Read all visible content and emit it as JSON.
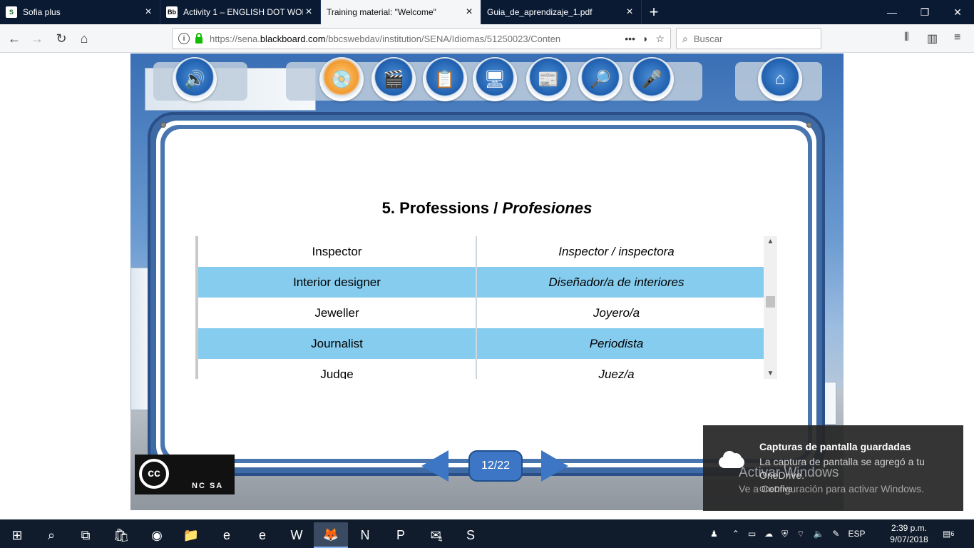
{
  "browser": {
    "tabs": [
      {
        "title": "Sofia plus",
        "favicon": "sofia-plus-icon"
      },
      {
        "title": "Activity 1 – ENGLISH DOT WOR",
        "favicon": "blackboard-icon"
      },
      {
        "title": "Training material: \"Welcome\"",
        "favicon": "none",
        "active": true
      },
      {
        "title": "Guia_de_aprendizaje_1.pdf",
        "favicon": "none"
      }
    ],
    "url_prefix": "https://sena.",
    "url_domain": "blackboard.com",
    "url_rest": "/bbcswebdav/institution/SENA/Idiomas/51250023/Conten",
    "url_more": "•••",
    "search_placeholder": "Buscar",
    "new_tab": "+",
    "nav": {
      "back": "←",
      "forward": "→",
      "reload": "↻",
      "home": "⌂"
    }
  },
  "lesson": {
    "heading_en": "5. Professions / ",
    "heading_es": "Profesiones",
    "rows": [
      {
        "en": "Inspector",
        "es": "Inspector / inspectora"
      },
      {
        "en": "Interior designer",
        "es": "Diseñador/a de interiores"
      },
      {
        "en": "Jeweller",
        "es": "Joyero/a"
      },
      {
        "en": "Journalist",
        "es": "Periodista"
      },
      {
        "en": "Judge",
        "es": "Juez/a"
      }
    ],
    "page_indicator": "12/22",
    "license": {
      "cc": "cc",
      "tags": "NC  SA"
    }
  },
  "toolbar_icons": [
    "speaker-icon",
    "cd-icon",
    "clapperboard-icon",
    "checklist-icon",
    "computer-icon",
    "documents-icon",
    "magnifier-book-icon",
    "microphone-icon",
    "home-icon"
  ],
  "toast": {
    "title": "Capturas de pantalla guardadas",
    "body": "La captura de pantalla se agregó a tu OneDrive.",
    "source": "OneDrive"
  },
  "watermark": {
    "line1": "Activar Windows",
    "line2": "Ve a Configuración para activar Windows."
  },
  "taskbar": {
    "language": "ESP",
    "time": "2:39 p.m.",
    "date": "9/07/2018",
    "notifications": "6",
    "mail_badge": "4"
  },
  "colors": {
    "row_highlight": "#86ccee",
    "frame_blue": "#3e6aa5",
    "accent_button": "#3d76c4"
  }
}
